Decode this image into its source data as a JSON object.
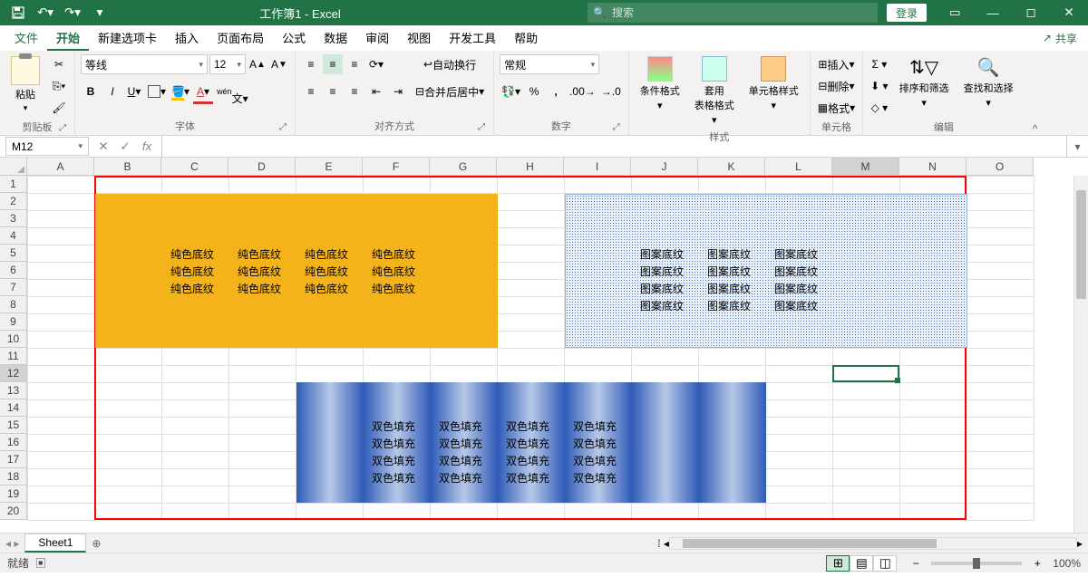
{
  "app": {
    "title": "工作簿1  -  Excel",
    "login": "登录",
    "search_placeholder": "搜索"
  },
  "tabs": {
    "file": "文件",
    "home": "开始",
    "new_tab": "新建选项卡",
    "insert": "插入",
    "layout": "页面布局",
    "formulas": "公式",
    "data": "数据",
    "review": "审阅",
    "view": "视图",
    "dev": "开发工具",
    "help": "帮助",
    "share": "共享"
  },
  "ribbon": {
    "clipboard": {
      "paste": "粘贴",
      "label": "剪贴板"
    },
    "font": {
      "name": "等线",
      "size": "12",
      "label": "字体",
      "pinyin": "wén"
    },
    "alignment": {
      "label": "对齐方式",
      "wrap": "自动换行",
      "merge": "合并后居中"
    },
    "number": {
      "label": "数字",
      "format": "常规"
    },
    "styles": {
      "label": "样式",
      "cond": "条件格式",
      "table": "套用\n表格格式",
      "cell": "单元格样式"
    },
    "cells": {
      "label": "单元格",
      "insert": "插入",
      "delete": "删除",
      "format": "格式"
    },
    "editing": {
      "label": "编辑",
      "sort": "排序和筛选",
      "find": "查找和选择"
    }
  },
  "name_box": "M12",
  "columns": [
    "A",
    "B",
    "C",
    "D",
    "E",
    "F",
    "G",
    "H",
    "I",
    "J",
    "K",
    "L",
    "M",
    "N",
    "O"
  ],
  "row_count": 20,
  "content": {
    "solid": "纯色底纹",
    "pattern": "图案底纹",
    "gradient": "双色填充"
  },
  "sheet": {
    "name": "Sheet1"
  },
  "status": {
    "ready": "就绪",
    "zoom": "100%"
  }
}
